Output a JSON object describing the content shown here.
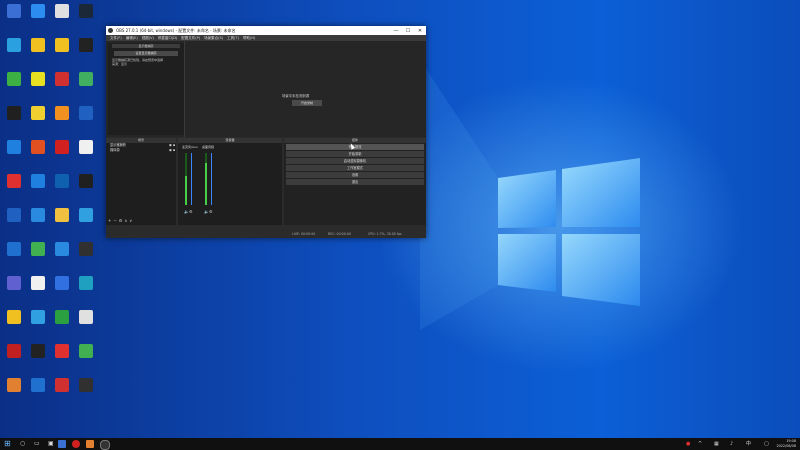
{
  "desktop": {
    "icons": [
      {
        "label": "",
        "color": "#3b6fd4"
      },
      {
        "label": "",
        "color": "#2d8cf0"
      },
      {
        "label": "",
        "color": "#e0e0e0"
      },
      {
        "label": "",
        "color": "#1b2838"
      },
      {
        "label": "",
        "color": "#2aa0e0"
      },
      {
        "label": "",
        "color": "#f0c020"
      },
      {
        "label": "",
        "color": "#f0c020"
      },
      {
        "label": "",
        "color": "#222222"
      },
      {
        "label": "",
        "color": "#3cb043"
      },
      {
        "label": "",
        "color": "#e8e020"
      },
      {
        "label": "",
        "color": "#d03030"
      },
      {
        "label": "",
        "color": "#40b060"
      },
      {
        "label": "",
        "color": "#202020"
      },
      {
        "label": "",
        "color": "#f0d030"
      },
      {
        "label": "",
        "color": "#f09020"
      },
      {
        "label": "",
        "color": "#2060c0"
      },
      {
        "label": "",
        "color": "#2080e0"
      },
      {
        "label": "",
        "color": "#e05020"
      },
      {
        "label": "",
        "color": "#d02020"
      },
      {
        "label": "",
        "color": "#f0f0f0"
      },
      {
        "label": "",
        "color": "#e03030"
      },
      {
        "label": "",
        "color": "#2080e0"
      },
      {
        "label": "",
        "color": "#1060b0"
      },
      {
        "label": "",
        "color": "#202020"
      },
      {
        "label": "",
        "color": "#2060c0"
      },
      {
        "label": "",
        "color": "#2a8ae0"
      },
      {
        "label": "",
        "color": "#f0c040"
      },
      {
        "label": "",
        "color": "#30a0e0"
      },
      {
        "label": "",
        "color": "#2070d0"
      },
      {
        "label": "",
        "color": "#40b050"
      },
      {
        "label": "",
        "color": "#2a8ae0"
      },
      {
        "label": "",
        "color": "#303030"
      },
      {
        "label": "",
        "color": "#6060d0"
      },
      {
        "label": "",
        "color": "#f0f0f0"
      },
      {
        "label": "",
        "color": "#3070e0"
      },
      {
        "label": "",
        "color": "#20a0c0"
      },
      {
        "label": "",
        "color": "#f0c020"
      },
      {
        "label": "",
        "color": "#30a0e0"
      },
      {
        "label": "",
        "color": "#2aa040"
      },
      {
        "label": "",
        "color": "#e0e0e0"
      },
      {
        "label": "",
        "color": "#c02020"
      },
      {
        "label": "",
        "color": "#222222"
      },
      {
        "label": "",
        "color": "#e03030"
      },
      {
        "label": "",
        "color": "#40b050"
      },
      {
        "label": "",
        "color": "#e08030"
      },
      {
        "label": "",
        "color": "#2070d0"
      },
      {
        "label": "",
        "color": "#d03030"
      },
      {
        "label": "",
        "color": "#303030"
      }
    ]
  },
  "obs": {
    "title": "OBS 27.0.1 (64-bit, windows) - 配置文件: 未命名 - 场景: 未命名",
    "menu": [
      "文件(F)",
      "编辑(E)",
      "视图(V)",
      "停靠窗口(D)",
      "配置文件(P)",
      "场景集合(S)",
      "工具(T)",
      "帮助(H)"
    ],
    "source_select": "显示器捕获",
    "source_button": "设置显示器捕获",
    "source_text": [
      "显示器捕获源已找到，请在预览中选择",
      "来源：显示"
    ],
    "center_text": "场景中未检测到源",
    "center_button": "开始录制",
    "preview_label": "未选定来源",
    "radio_a": "声音",
    "radio_b": "已锁",
    "docks": {
      "scenes": "场景",
      "sources": "来源",
      "mixer": "混音器",
      "controls": "控件"
    },
    "scenes": [
      "显示器捕获",
      "媒体源"
    ],
    "mixer_channels": [
      {
        "name": "麦克风/Aux",
        "level": 0.55
      },
      {
        "name": "桌面音频",
        "level": 0.8
      }
    ],
    "controls": [
      "停止推流",
      "开始录制",
      "启动虚拟摄像机",
      "工作室模式",
      "设置",
      "退出"
    ],
    "status": {
      "live": "LIVE: 00:00:00",
      "rec": "REC: 00:00:00",
      "cpu": "CPU: 1.7%, 30.00 fps"
    }
  },
  "taskbar": {
    "time": "19:08",
    "date": "2022/08/08",
    "tray_icons": [
      "antivirus-icon",
      "chevron-up-icon",
      "network-icon",
      "volume-icon",
      "notification-icon"
    ]
  }
}
